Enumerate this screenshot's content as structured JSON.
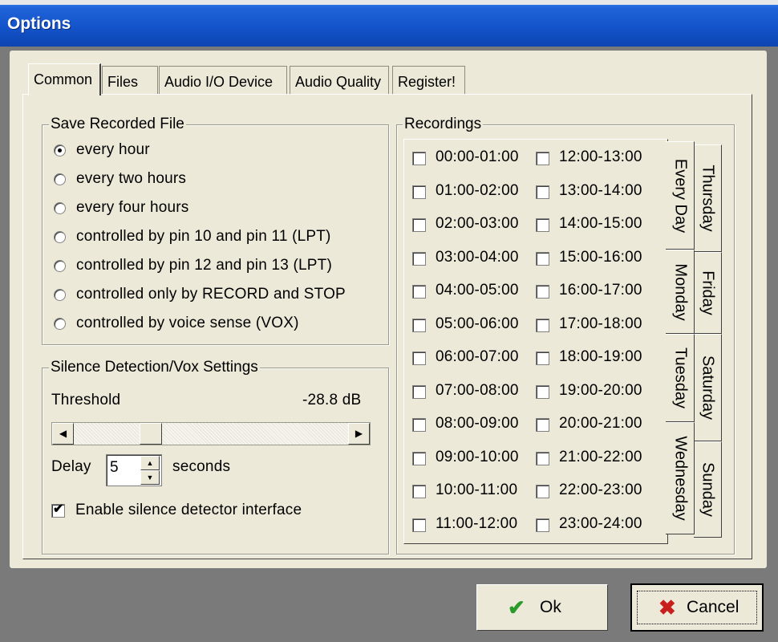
{
  "window": {
    "title": "Options"
  },
  "tabs": [
    "Common",
    "Files",
    "Audio I/O Device",
    "Audio Quality",
    "Register!"
  ],
  "save_recorded_file": {
    "legend": "Save Recorded File",
    "options": [
      {
        "label": "every hour",
        "selected": true
      },
      {
        "label": "every two hours",
        "selected": false
      },
      {
        "label": "every four hours",
        "selected": false
      },
      {
        "label": "controlled by pin 10 and pin 11 (LPT)",
        "selected": false
      },
      {
        "label": "controlled by pin 12 and pin 13 (LPT)",
        "selected": false
      },
      {
        "label": "controlled only by RECORD and STOP",
        "selected": false
      },
      {
        "label": "controlled by voice sense (VOX)",
        "selected": false
      }
    ]
  },
  "silence": {
    "legend": "Silence Detection/Vox Settings",
    "threshold_label": "Threshold",
    "threshold_value": "-28.8 dB",
    "slider_position": 0.26,
    "delay_label": "Delay",
    "delay_value": "5",
    "delay_unit": "seconds",
    "enable_label": "Enable silence detector interface",
    "enable_checked": true
  },
  "recordings": {
    "legend": "Recordings",
    "left_slots": [
      "00:00-01:00",
      "01:00-02:00",
      "02:00-03:00",
      "03:00-04:00",
      "04:00-05:00",
      "05:00-06:00",
      "06:00-07:00",
      "07:00-08:00",
      "08:00-09:00",
      "09:00-10:00",
      "10:00-11:00",
      "11:00-12:00"
    ],
    "right_slots": [
      "12:00-13:00",
      "13:00-14:00",
      "14:00-15:00",
      "15:00-16:00",
      "16:00-17:00",
      "17:00-18:00",
      "18:00-19:00",
      "19:00-20:00",
      "20:00-21:00",
      "21:00-22:00",
      "22:00-23:00",
      "23:00-24:00"
    ],
    "day_tabs_inner": [
      "Every Day",
      "Monday",
      "Tuesday",
      "Wednesday"
    ],
    "day_tabs_outer": [
      "Thursday",
      "Friday",
      "Saturday",
      "Sunday"
    ]
  },
  "buttons": {
    "ok": "Ok",
    "cancel": "Cancel"
  },
  "colors": {
    "ok_icon": "#2a9a2a",
    "cancel_icon": "#c81e1e",
    "title_bar": "#1353c9"
  },
  "icons": {
    "ok": "checkmark-icon",
    "cancel": "x-icon"
  }
}
